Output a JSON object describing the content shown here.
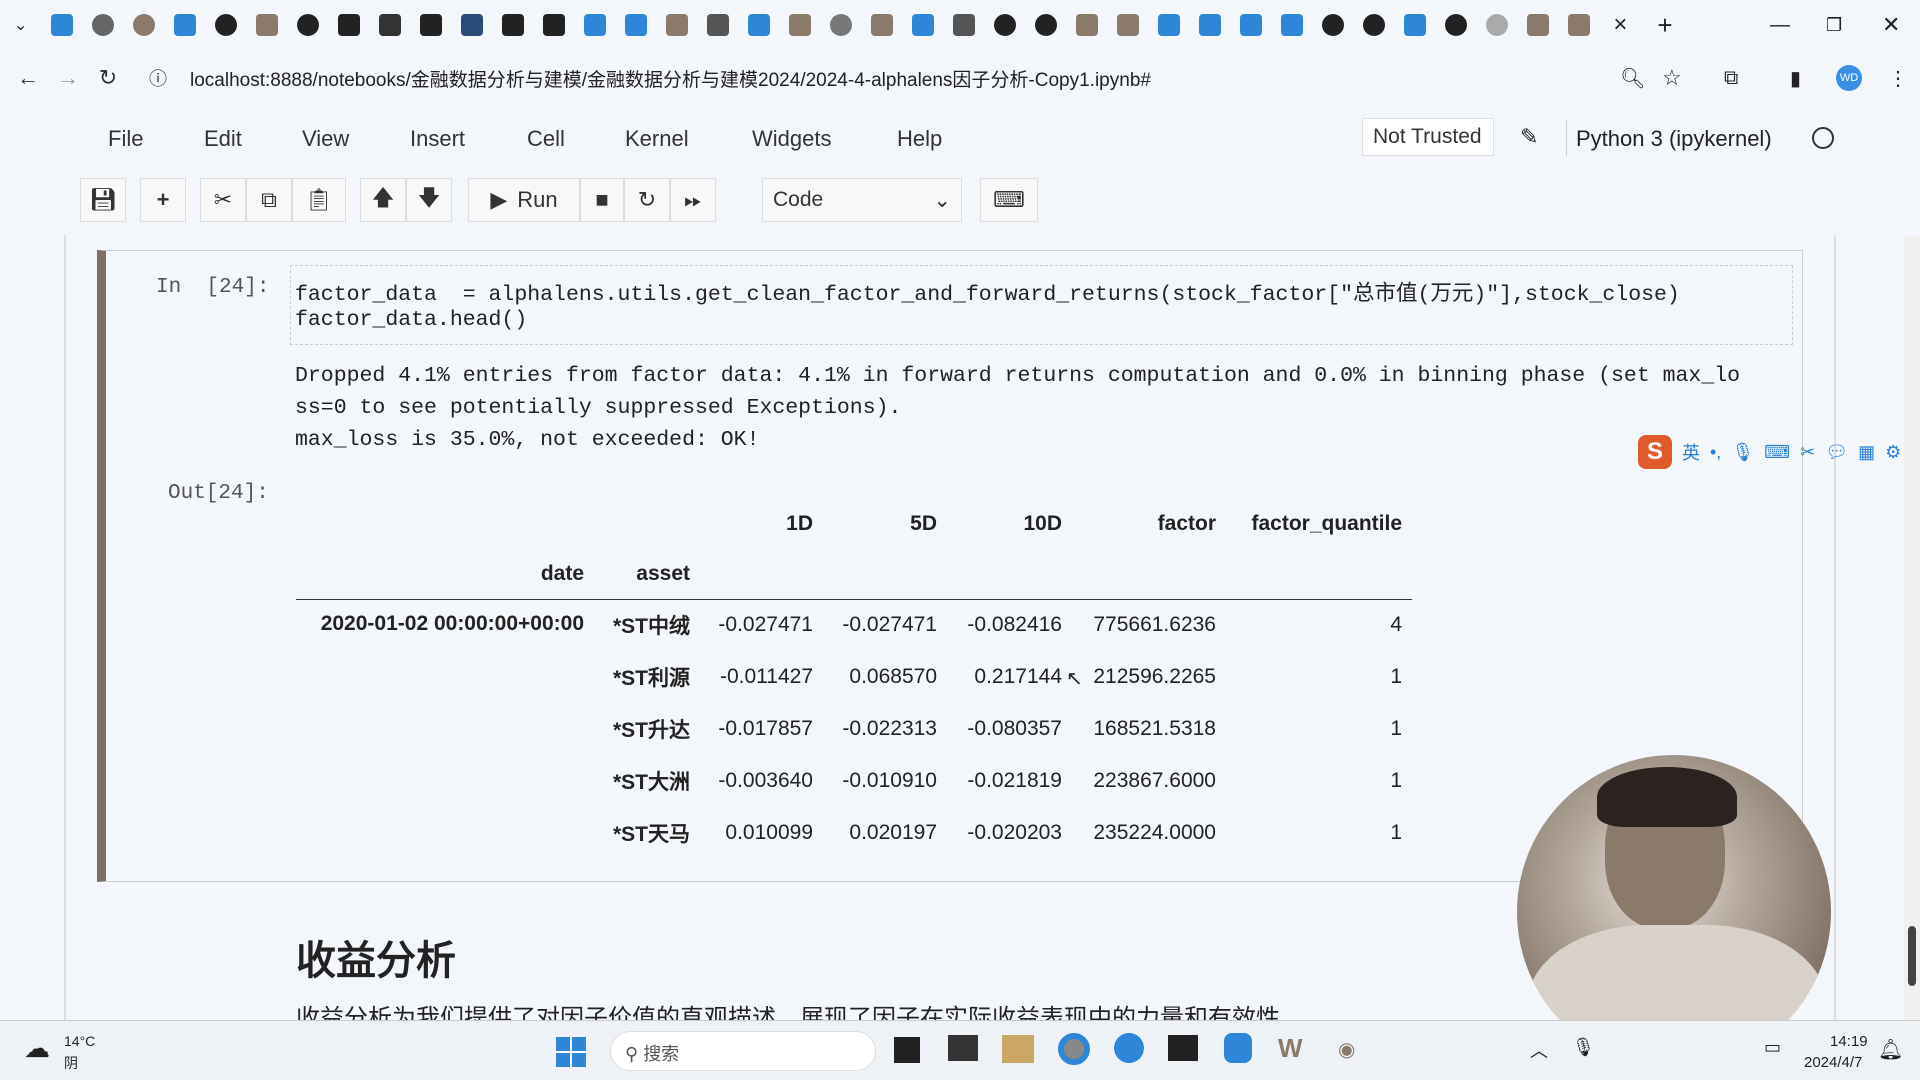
{
  "browser": {
    "url": "localhost:8888/notebooks/金融数据分析与建模/金融数据分析与建模2024/2024-4-alphalens因子分析-Copy1.ipynb#",
    "tab_icons": [
      "bilibili",
      "chat",
      "circle",
      "zhihu",
      "github",
      "c",
      "github",
      "n",
      "ai",
      "mail",
      "tds",
      "pen",
      "pen",
      "cloud",
      "cloud",
      "run",
      "book",
      "paw",
      "google",
      "globe",
      "q",
      "bird",
      "book",
      "github",
      "github",
      "c",
      "c",
      "blue",
      "zhihu",
      "zhihu",
      "zhihu",
      "github",
      "github",
      "blue",
      "github",
      "loading",
      "edit",
      "edit"
    ],
    "close_tab": "×",
    "new_tab": "+"
  },
  "menu": [
    "File",
    "Edit",
    "View",
    "Insert",
    "Cell",
    "Kernel",
    "Widgets",
    "Help"
  ],
  "status": {
    "trusted": "Not Trusted",
    "kernel": "Python 3 (ipykernel)"
  },
  "toolbar": {
    "run": "Run",
    "cell_type": "Code"
  },
  "cell": {
    "in_prompt": "In  [24]:",
    "code": [
      "factor_data  = alphalens.utils.get_clean_factor_and_forward_returns(stock_factor[\"总市值(万元)\"],stock_close)",
      "factor_data.head()"
    ],
    "stdout": [
      "Dropped 4.1% entries from factor data: 4.1% in forward returns computation and 0.0% in binning phase (set max_lo",
      "ss=0 to see potentially suppressed Exceptions).",
      "max_loss is 35.0%, not exceeded: OK!"
    ],
    "out_prompt": "Out[24]:",
    "table": {
      "columns": [
        "1D",
        "5D",
        "10D",
        "factor",
        "factor_quantile"
      ],
      "index_names": [
        "date",
        "asset"
      ],
      "date": "2020-01-02 00:00:00+00:00",
      "rows": [
        [
          "*ST中绒",
          "-0.027471",
          "-0.027471",
          "-0.082416",
          "775661.6236",
          "4"
        ],
        [
          "*ST利源",
          "-0.011427",
          "0.068570",
          "0.217144",
          "212596.2265",
          "1"
        ],
        [
          "*ST升达",
          "-0.017857",
          "-0.022313",
          "-0.080357",
          "168521.5318",
          "1"
        ],
        [
          "*ST大洲",
          "-0.003640",
          "-0.010910",
          "-0.021819",
          "223867.6000",
          "1"
        ],
        [
          "*ST天马",
          "0.010099",
          "0.020197",
          "-0.020203",
          "235224.0000",
          "1"
        ]
      ]
    }
  },
  "markdown": {
    "heading": "收益分析",
    "paragraph": "收益分析为我们提供了对因子价值的直观描述，展现了因子在实际收益表现中的力量和有效性"
  },
  "ime": {
    "lang": "英"
  },
  "taskbar": {
    "weather_temp": "14°C",
    "weather_desc": "阴",
    "search": "搜索",
    "time": "14:19",
    "date": "2024/4/7"
  }
}
